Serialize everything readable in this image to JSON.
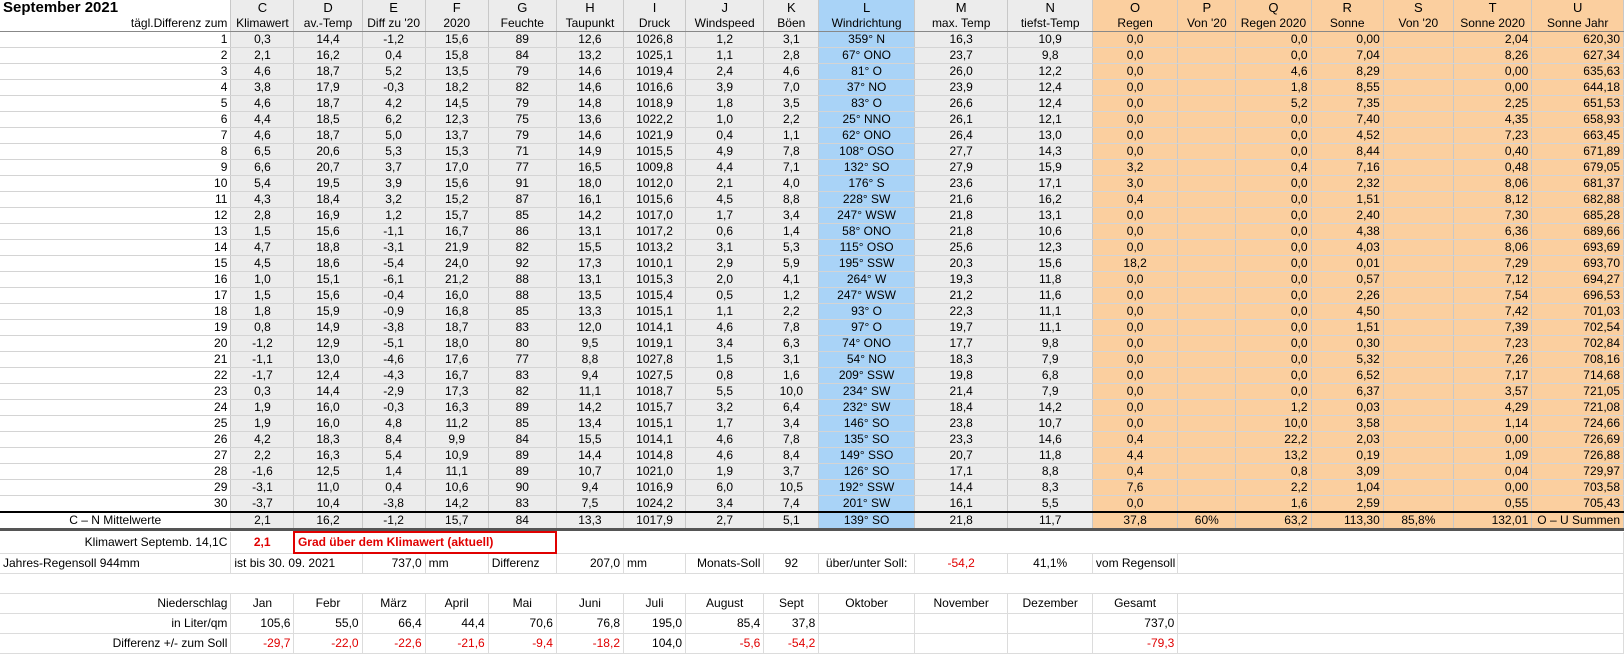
{
  "header": {
    "title": "September 2021",
    "letters": [
      "C",
      "D",
      "E",
      "F",
      "G",
      "H",
      "I",
      "J",
      "K",
      "L",
      "M",
      "N",
      "O",
      "P",
      "Q",
      "R",
      "S",
      "T",
      "U"
    ],
    "labels": [
      "tägl.Differenz zum",
      "Klimawert",
      "av.-Temp",
      "Diff zu '20",
      "2020",
      "Feuchte",
      "Taupunkt",
      "Druck",
      "Windspeed",
      "Böen",
      "Windrichtung",
      "max. Temp",
      "tiefst-Temp",
      "Regen",
      "Von '20",
      "Regen 2020",
      "Sonne",
      "Von '20",
      "Sonne 2020",
      "Sonne Jahr"
    ]
  },
  "rows": [
    [
      "1",
      "0,3",
      "14,4",
      "-1,2",
      "15,6",
      "89",
      "12,6",
      "1026,8",
      "1,2",
      "3,1",
      "359° N",
      "16,3",
      "10,9",
      "0,0",
      "",
      "0,0",
      "0,00",
      "",
      "2,04",
      "620,30"
    ],
    [
      "2",
      "2,1",
      "16,2",
      "0,4",
      "15,8",
      "84",
      "13,2",
      "1025,1",
      "1,1",
      "2,8",
      "67° ONO",
      "23,7",
      "9,8",
      "0,0",
      "",
      "0,0",
      "7,04",
      "",
      "8,26",
      "627,34"
    ],
    [
      "3",
      "4,6",
      "18,7",
      "5,2",
      "13,5",
      "79",
      "14,6",
      "1019,4",
      "2,4",
      "4,6",
      "81° O",
      "26,0",
      "12,2",
      "0,0",
      "",
      "4,6",
      "8,29",
      "",
      "0,00",
      "635,63"
    ],
    [
      "4",
      "3,8",
      "17,9",
      "-0,3",
      "18,2",
      "82",
      "14,6",
      "1016,6",
      "3,9",
      "7,0",
      "37° NO",
      "23,9",
      "12,4",
      "0,0",
      "",
      "1,8",
      "8,55",
      "",
      "0,00",
      "644,18"
    ],
    [
      "5",
      "4,6",
      "18,7",
      "4,2",
      "14,5",
      "79",
      "14,8",
      "1018,9",
      "1,8",
      "3,5",
      "83° O",
      "26,6",
      "12,4",
      "0,0",
      "",
      "5,2",
      "7,35",
      "",
      "2,25",
      "651,53"
    ],
    [
      "6",
      "4,4",
      "18,5",
      "6,2",
      "12,3",
      "75",
      "13,6",
      "1022,2",
      "1,0",
      "2,2",
      "25° NNO",
      "26,1",
      "12,1",
      "0,0",
      "",
      "0,0",
      "7,40",
      "",
      "4,35",
      "658,93"
    ],
    [
      "7",
      "4,6",
      "18,7",
      "5,0",
      "13,7",
      "79",
      "14,6",
      "1021,9",
      "0,4",
      "1,1",
      "62° ONO",
      "26,4",
      "13,0",
      "0,0",
      "",
      "0,0",
      "4,52",
      "",
      "7,23",
      "663,45"
    ],
    [
      "8",
      "6,5",
      "20,6",
      "5,3",
      "15,3",
      "71",
      "14,9",
      "1015,5",
      "4,9",
      "7,8",
      "108° OSO",
      "27,7",
      "14,3",
      "0,0",
      "",
      "0,0",
      "8,44",
      "",
      "0,40",
      "671,89"
    ],
    [
      "9",
      "6,6",
      "20,7",
      "3,7",
      "17,0",
      "77",
      "16,5",
      "1009,8",
      "4,4",
      "7,1",
      "132° SO",
      "27,9",
      "15,9",
      "3,2",
      "",
      "0,4",
      "7,16",
      "",
      "0,48",
      "679,05"
    ],
    [
      "10",
      "5,4",
      "19,5",
      "3,9",
      "15,6",
      "91",
      "18,0",
      "1012,0",
      "2,1",
      "4,0",
      "176° S",
      "23,6",
      "17,1",
      "3,0",
      "",
      "0,0",
      "2,32",
      "",
      "8,06",
      "681,37"
    ],
    [
      "11",
      "4,3",
      "18,4",
      "3,2",
      "15,2",
      "87",
      "16,1",
      "1015,6",
      "4,5",
      "8,8",
      "228° SW",
      "21,6",
      "16,2",
      "0,4",
      "",
      "0,0",
      "1,51",
      "",
      "8,12",
      "682,88"
    ],
    [
      "12",
      "2,8",
      "16,9",
      "1,2",
      "15,7",
      "85",
      "14,2",
      "1017,0",
      "1,7",
      "3,4",
      "247° WSW",
      "21,8",
      "13,1",
      "0,0",
      "",
      "0,0",
      "2,40",
      "",
      "7,30",
      "685,28"
    ],
    [
      "13",
      "1,5",
      "15,6",
      "-1,1",
      "16,7",
      "86",
      "13,1",
      "1017,2",
      "0,6",
      "1,4",
      "58° ONO",
      "21,8",
      "10,6",
      "0,0",
      "",
      "0,0",
      "4,38",
      "",
      "6,36",
      "689,66"
    ],
    [
      "14",
      "4,7",
      "18,8",
      "-3,1",
      "21,9",
      "82",
      "15,5",
      "1013,2",
      "3,1",
      "5,3",
      "115° OSO",
      "25,6",
      "12,3",
      "0,0",
      "",
      "0,0",
      "4,03",
      "",
      "8,06",
      "693,69"
    ],
    [
      "15",
      "4,5",
      "18,6",
      "-5,4",
      "24,0",
      "92",
      "17,3",
      "1010,1",
      "2,9",
      "5,9",
      "195° SSW",
      "20,3",
      "15,6",
      "18,2",
      "",
      "0,0",
      "0,01",
      "",
      "7,29",
      "693,70"
    ],
    [
      "16",
      "1,0",
      "15,1",
      "-6,1",
      "21,2",
      "88",
      "13,1",
      "1015,3",
      "2,0",
      "4,1",
      "264° W",
      "19,3",
      "11,8",
      "0,0",
      "",
      "0,0",
      "0,57",
      "",
      "7,12",
      "694,27"
    ],
    [
      "17",
      "1,5",
      "15,6",
      "-0,4",
      "16,0",
      "88",
      "13,5",
      "1015,4",
      "0,5",
      "1,2",
      "247° WSW",
      "21,2",
      "11,6",
      "0,0",
      "",
      "0,0",
      "2,26",
      "",
      "7,54",
      "696,53"
    ],
    [
      "18",
      "1,8",
      "15,9",
      "-0,9",
      "16,8",
      "85",
      "13,3",
      "1015,1",
      "1,1",
      "2,2",
      "93° O",
      "22,3",
      "11,1",
      "0,0",
      "",
      "0,0",
      "4,50",
      "",
      "7,42",
      "701,03"
    ],
    [
      "19",
      "0,8",
      "14,9",
      "-3,8",
      "18,7",
      "83",
      "12,0",
      "1014,1",
      "4,6",
      "7,8",
      "97° O",
      "19,7",
      "11,1",
      "0,0",
      "",
      "0,0",
      "1,51",
      "",
      "7,39",
      "702,54"
    ],
    [
      "20",
      "-1,2",
      "12,9",
      "-5,1",
      "18,0",
      "80",
      "9,5",
      "1019,1",
      "3,4",
      "6,3",
      "74° ONO",
      "17,7",
      "9,8",
      "0,0",
      "",
      "0,0",
      "0,30",
      "",
      "7,23",
      "702,84"
    ],
    [
      "21",
      "-1,1",
      "13,0",
      "-4,6",
      "17,6",
      "77",
      "8,8",
      "1027,8",
      "1,5",
      "3,1",
      "54° NO",
      "18,3",
      "7,9",
      "0,0",
      "",
      "0,0",
      "5,32",
      "",
      "7,26",
      "708,16"
    ],
    [
      "22",
      "-1,7",
      "12,4",
      "-4,3",
      "16,7",
      "83",
      "9,4",
      "1027,5",
      "0,8",
      "1,6",
      "209° SSW",
      "19,8",
      "6,8",
      "0,0",
      "",
      "0,0",
      "6,52",
      "",
      "7,17",
      "714,68"
    ],
    [
      "23",
      "0,3",
      "14,4",
      "-2,9",
      "17,3",
      "82",
      "11,1",
      "1018,7",
      "5,5",
      "10,0",
      "234° SW",
      "21,4",
      "7,9",
      "0,0",
      "",
      "0,0",
      "6,37",
      "",
      "3,57",
      "721,05"
    ],
    [
      "24",
      "1,9",
      "16,0",
      "-0,3",
      "16,3",
      "89",
      "14,2",
      "1015,7",
      "3,2",
      "6,4",
      "232° SW",
      "18,4",
      "14,2",
      "0,0",
      "",
      "1,2",
      "0,03",
      "",
      "4,29",
      "721,08"
    ],
    [
      "25",
      "1,9",
      "16,0",
      "4,8",
      "11,2",
      "85",
      "13,4",
      "1015,1",
      "1,7",
      "3,4",
      "146° SO",
      "23,8",
      "10,7",
      "0,0",
      "",
      "10,0",
      "3,58",
      "",
      "1,14",
      "724,66"
    ],
    [
      "26",
      "4,2",
      "18,3",
      "8,4",
      "9,9",
      "84",
      "15,5",
      "1014,1",
      "4,6",
      "7,8",
      "135° SO",
      "23,3",
      "14,6",
      "0,4",
      "",
      "22,2",
      "2,03",
      "",
      "0,00",
      "726,69"
    ],
    [
      "27",
      "2,2",
      "16,3",
      "5,4",
      "10,9",
      "89",
      "14,4",
      "1014,8",
      "4,6",
      "8,4",
      "149° SSO",
      "20,7",
      "11,8",
      "4,4",
      "",
      "13,2",
      "0,19",
      "",
      "1,09",
      "726,88"
    ],
    [
      "28",
      "-1,6",
      "12,5",
      "1,4",
      "11,1",
      "89",
      "10,7",
      "1021,0",
      "1,9",
      "3,7",
      "126° SO",
      "17,1",
      "8,8",
      "0,4",
      "",
      "0,8",
      "3,09",
      "",
      "0,04",
      "729,97"
    ],
    [
      "29",
      "-3,1",
      "11,0",
      "0,4",
      "10,6",
      "90",
      "9,4",
      "1016,9",
      "6,0",
      "10,5",
      "192° SSW",
      "14,4",
      "8,3",
      "7,6",
      "",
      "2,2",
      "1,04",
      "",
      "0,00",
      "703,58"
    ],
    [
      "30",
      "-3,7",
      "10,4",
      "-3,8",
      "14,2",
      "83",
      "7,5",
      "1024,2",
      "3,4",
      "7,4",
      "201° SW",
      "16,1",
      "5,5",
      "0,0",
      "",
      "1,6",
      "2,59",
      "",
      "0,55",
      "705,43"
    ]
  ],
  "mean_row": [
    "C – N Mittelwerte",
    "2,1",
    "16,2",
    "-1,2",
    "15,7",
    "84",
    "13,3",
    "1017,9",
    "2,7",
    "5,1",
    "139° SO",
    "21,8",
    "11,7",
    "37,8",
    "60%",
    "63,2",
    "113,30",
    "85,8%",
    "132,01",
    "O – U Summen"
  ],
  "klima": {
    "label": "Klimawert Septemb. 14,1C",
    "value": "2,1",
    "text": "Grad über dem Klimawert (aktuell)"
  },
  "regen": {
    "label": "Jahres-Regensoll 944mm",
    "until": "ist bis 30. 09. 2021",
    "amount": "737,0",
    "unit": "mm",
    "diff_label": "Differenz",
    "diff": "207,0",
    "diff_unit": "mm",
    "monats_label": "Monats-Soll",
    "monats": "92",
    "ueber_label": "über/unter Soll:",
    "ueber": "-54,2",
    "percent": "41,1%",
    "vom": "vom Regensoll"
  },
  "months": {
    "label": "Niederschlag",
    "names": [
      "Jan",
      "Febr",
      "März",
      "April",
      "Mai",
      "Juni",
      "Juli",
      "August",
      "Sept",
      "Oktober",
      "November",
      "Dezember",
      "Gesamt"
    ],
    "liter_label": "in Liter/qm",
    "liter": [
      "105,6",
      "55,0",
      "66,4",
      "44,4",
      "70,6",
      "76,8",
      "195,0",
      "85,4",
      "37,8",
      "",
      "",
      "",
      "737,0"
    ],
    "diff_label": "Differenz  +/- zum Soll",
    "diff": [
      "-29,7",
      "-22,0",
      "-22,6",
      "-21,6",
      "-9,4",
      "-18,2",
      "104,0",
      "-5,6",
      "-54,2",
      "",
      "",
      "",
      "-79,3"
    ]
  }
}
